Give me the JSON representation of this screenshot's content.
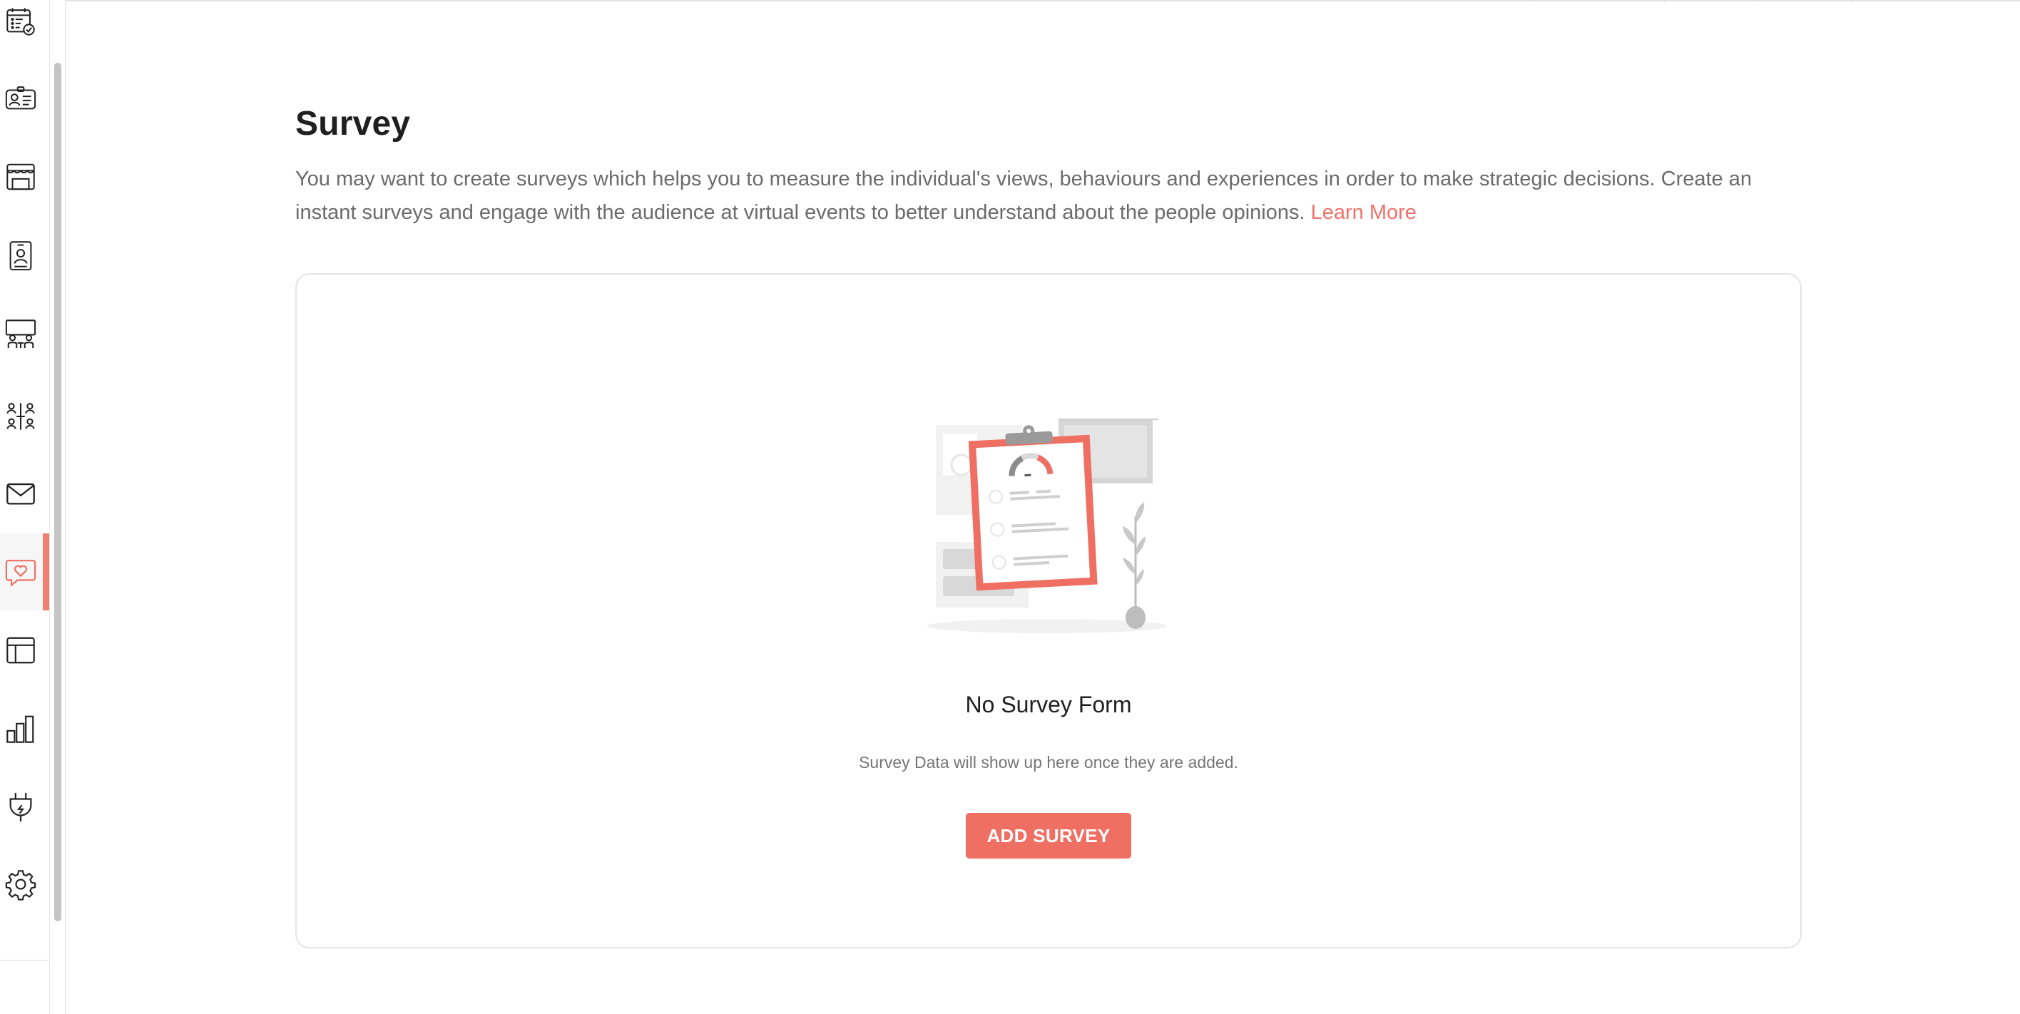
{
  "sidebar": {
    "items": [
      {
        "icon": "calendar-check-icon"
      },
      {
        "icon": "contact-card-icon"
      },
      {
        "icon": "booth-icon"
      },
      {
        "icon": "badge-icon"
      },
      {
        "icon": "presentation-icon"
      },
      {
        "icon": "networking-icon"
      },
      {
        "icon": "email-icon"
      },
      {
        "icon": "survey-heart-icon",
        "active": true
      },
      {
        "icon": "layout-icon"
      },
      {
        "icon": "analytics-icon"
      },
      {
        "icon": "integration-plug-icon"
      },
      {
        "icon": "settings-gear-icon"
      }
    ]
  },
  "header": {
    "title": "Survey",
    "description": "You may want to create surveys which helps you to measure the individual's views, behaviours and experiences in order to make strategic decisions. Create an instant surveys and engage with the audience at virtual events to better understand about the people opinions.",
    "learn_more": "Learn More"
  },
  "empty_state": {
    "title": "No Survey Form",
    "subtitle": "Survey Data will show up here once they are added.",
    "button_label": "ADD SURVEY"
  },
  "colors": {
    "accent": "#ef6f63",
    "link": "#f0726a",
    "text_primary": "#1f1f1f",
    "text_secondary": "#6b6b6b"
  }
}
